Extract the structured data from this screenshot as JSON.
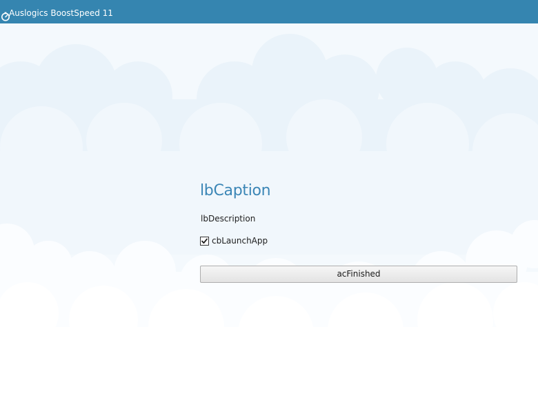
{
  "window": {
    "title": "Auslogics BoostSpeed 11",
    "icon": "boostspeed-gauge-icon"
  },
  "finish_page": {
    "caption": "lbCaption",
    "description": "lbDescription",
    "launch_checkbox": {
      "label": "cbLaunchApp",
      "checked": true
    },
    "finish_button_label": "acFinished"
  },
  "colors": {
    "titlebar": "#3585b0",
    "caption": "#3b86b6",
    "background": "#f4f9fd"
  }
}
